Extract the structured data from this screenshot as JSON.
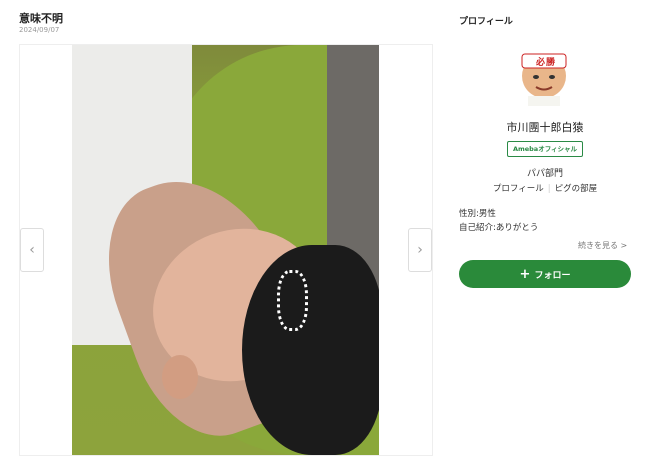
{
  "post": {
    "title": "意味不明",
    "date": "2024/09/07"
  },
  "slider": {
    "prev_icon": "chevron-left-icon",
    "next_icon": "chevron-right-icon"
  },
  "profile": {
    "heading": "プロフィール",
    "name": "市川團十郎白猿",
    "badge": "Amebaオフィシャル",
    "category": "パパ部門",
    "links": [
      "プロフィール",
      "ピグの部屋"
    ],
    "gender": "性別:男性",
    "intro": "自己紹介:ありがとう",
    "read_more": "続きを見る >",
    "follow_label": "フォロー",
    "avatar_text": [
      "必",
      "勝"
    ]
  },
  "colors": {
    "accent_green": "#2a8a3a",
    "badge_green": "#2a8a45"
  }
}
